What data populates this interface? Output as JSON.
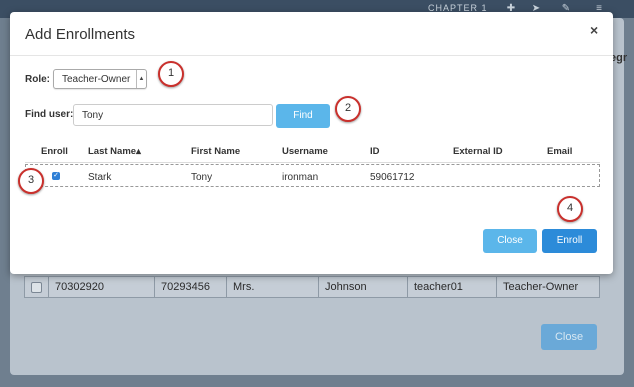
{
  "background": {
    "topbar_title": "CHAPTER 1",
    "header_cut": "egr",
    "row": {
      "cells": [
        "",
        "70302920",
        "70293456",
        "Mrs.",
        "Johnson",
        "teacher01",
        "Teacher-Owner"
      ]
    },
    "close_label": "Close"
  },
  "modal": {
    "title": "Add Enrollments",
    "close_glyph": "×",
    "role_label": "Role:",
    "role_value": "Teacher-Owner",
    "find_label": "Find user:",
    "find_value": "Tony",
    "find_button": "Find",
    "table": {
      "headers": {
        "enroll": "Enroll",
        "last_name": "Last Name",
        "sort_glyph": "▴",
        "first_name": "First Name",
        "username": "Username",
        "id": "ID",
        "external_id": "External ID",
        "email": "Email"
      },
      "rows": [
        {
          "last_name": "Stark",
          "first_name": "Tony",
          "username": "ironman",
          "id": "59061712",
          "external_id": "",
          "email": "",
          "checked": true
        }
      ]
    },
    "close_button": "Close",
    "enroll_button": "Enroll"
  },
  "callouts": [
    "1",
    "2",
    "3",
    "4"
  ],
  "colors": {
    "primary": "#2c8bd9",
    "secondary": "#5bb6ea",
    "callout_border": "#c9302c"
  }
}
